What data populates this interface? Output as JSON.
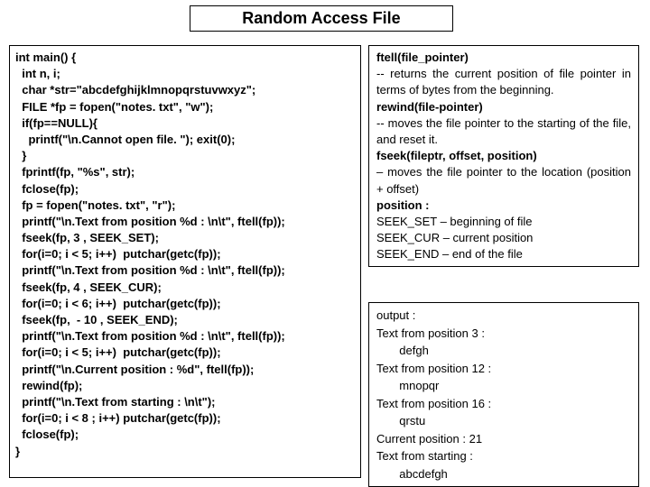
{
  "title": "Random Access File",
  "code": "int main() {\n  int n, i;\n  char *str=\"abcdefghijklmnopqrstuvwxyz\";\n  FILE *fp = fopen(\"notes. txt\", \"w\");\n  if(fp==NULL){\n    printf(\"\\n.Cannot open file. \"); exit(0);\n  }\n  fprintf(fp, \"%s\", str);\n  fclose(fp);\n  fp = fopen(\"notes. txt\", \"r\");\n  printf(\"\\n.Text from position %d : \\n\\t\", ftell(fp));\n  fseek(fp, 3 , SEEK_SET);\n  for(i=0; i < 5; i++)  putchar(getc(fp));\n  printf(\"\\n.Text from position %d : \\n\\t\", ftell(fp));\n  fseek(fp, 4 , SEEK_CUR);\n  for(i=0; i < 6; i++)  putchar(getc(fp));\n  fseek(fp,  - 10 , SEEK_END);\n  printf(\"\\n.Text from position %d : \\n\\t\", ftell(fp));\n  for(i=0; i < 5; i++)  putchar(getc(fp));\n  printf(\"\\n.Current position : %d\", ftell(fp));\n  rewind(fp);\n  printf(\"\\n.Text from starting : \\n\\t\");\n  for(i=0; i < 8 ; i++) putchar(getc(fp));\n  fclose(fp);\n}",
  "ref": {
    "ftell_h": "ftell(file_pointer)",
    "ftell_d": "  -- returns the current position of file pointer in terms of bytes from the beginning.",
    "rewind_h": "rewind(file-pointer)",
    "rewind_d": "  -- moves the file pointer to the starting of the file, and reset it.",
    "fseek_h": "fseek(fileptr, offset, position)",
    "fseek_d": " – moves the file pointer to the location (position + offset)",
    "pos_h": "position :",
    "pos_set": "  SEEK_SET – beginning of file",
    "pos_cur": "  SEEK_CUR – current position",
    "pos_end": "  SEEK_END – end of the file"
  },
  "output": "output :\nText from position 3 :\n       defgh\nText from position 12 :\n       mnopqr\nText from position 16 :\n       qrstu\nCurrent position : 21\nText from starting :\n       abcdefgh"
}
